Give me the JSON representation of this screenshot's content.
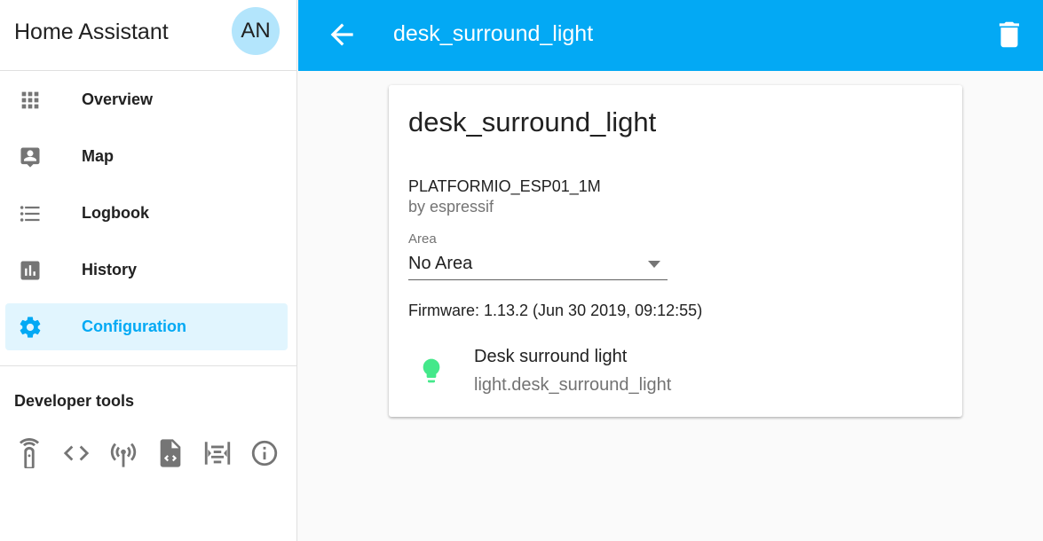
{
  "app": {
    "title": "Home Assistant",
    "avatar_initials": "AN"
  },
  "sidebar": {
    "items": [
      {
        "label": "Overview",
        "icon": "apps-icon"
      },
      {
        "label": "Map",
        "icon": "account-box-icon"
      },
      {
        "label": "Logbook",
        "icon": "format-list-bulleted-icon"
      },
      {
        "label": "History",
        "icon": "chart-box-icon"
      },
      {
        "label": "Configuration",
        "icon": "settings-icon",
        "active": true
      }
    ],
    "developer_tools_title": "Developer tools",
    "developer_tools": [
      "remote-icon",
      "code-tags-icon",
      "access-point-icon",
      "file-code-icon",
      "view-split-icon",
      "info-outline-icon"
    ]
  },
  "topbar": {
    "title": "desk_surround_light"
  },
  "device": {
    "name": "desk_surround_light",
    "model": "PLATFORMIO_ESP01_1M",
    "manufacturer": "by espressif",
    "area_label": "Area",
    "area_value": "No Area",
    "firmware": "Firmware: 1.13.2 (Jun 30 2019, 09:12:55)",
    "entity": {
      "name": "Desk surround light",
      "entity_id": "light.desk_surround_light",
      "icon": "lightbulb-icon",
      "icon_color": "#44e88a"
    }
  },
  "colors": {
    "accent": "#03a9f4",
    "active_background": "#e1f5fe",
    "sidebar_icon": "#757575"
  }
}
